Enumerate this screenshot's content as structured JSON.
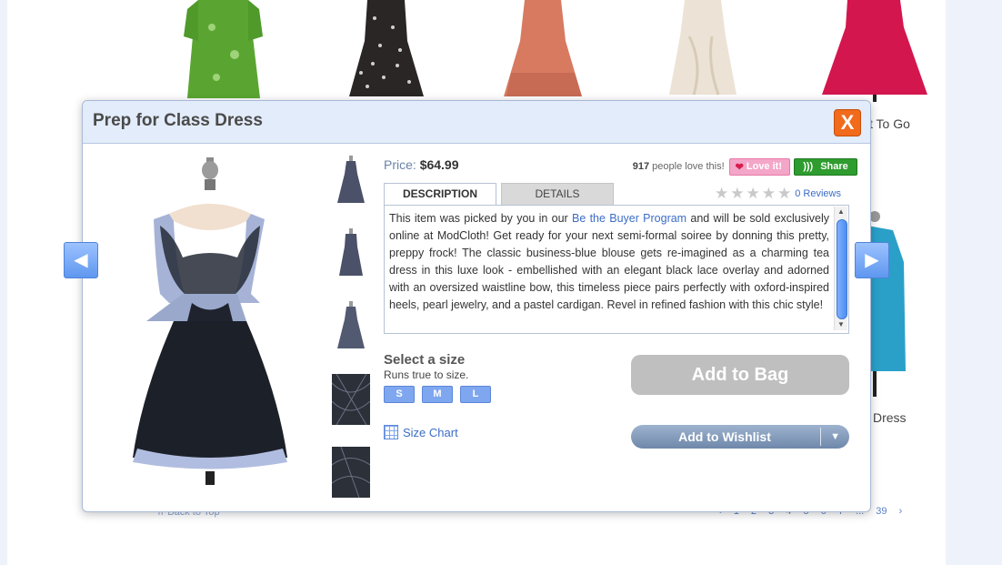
{
  "background": {
    "captions": [
      "t To Go",
      "Dress"
    ],
    "back_to_top": "Back to Top",
    "pager": [
      "1",
      "2",
      "3",
      "4",
      "5",
      "6",
      "7",
      "...",
      "39"
    ]
  },
  "modal": {
    "title": "Prep for Class Dress",
    "close_label": "X",
    "price_label": "Price:",
    "price_value": "$64.99",
    "love_count": "917",
    "love_text": "people love this!",
    "love_button": "Love it!",
    "share_button": "Share",
    "tabs": [
      "DESCRIPTION",
      "DETAILS"
    ],
    "reviews_link": "0 Reviews",
    "rating": 0,
    "description_before": "This item was picked by you in our ",
    "description_link": "Be the Buyer Program",
    "description_after": " and will be sold exclusively online at ModCloth! Get ready for your next semi-formal soiree by donning this pretty, preppy frock! The classic business-blue blouse gets re-imagined as a charming tea dress in this luxe look - embellished with an elegant black lace overlay and adorned with an oversized waistline bow, this timeless piece pairs perfectly with oxford-inspired heels, pearl jewelry, and a pastel cardigan. Revel in refined fashion with this chic style!",
    "size_title": "Select a size",
    "size_note": "Runs true to size.",
    "sizes": [
      "S",
      "M",
      "L"
    ],
    "size_chart": "Size Chart",
    "add_to_bag": "Add to Bag",
    "add_to_wishlist": "Add to Wishlist"
  },
  "icons": {
    "prev": "arrow-left-icon",
    "next": "arrow-right-icon",
    "close": "close-icon"
  },
  "colors": {
    "accent": "#3c6dc6",
    "close": "#f26a1b",
    "share": "#2e9c2e",
    "love": "#f4a6c8"
  }
}
